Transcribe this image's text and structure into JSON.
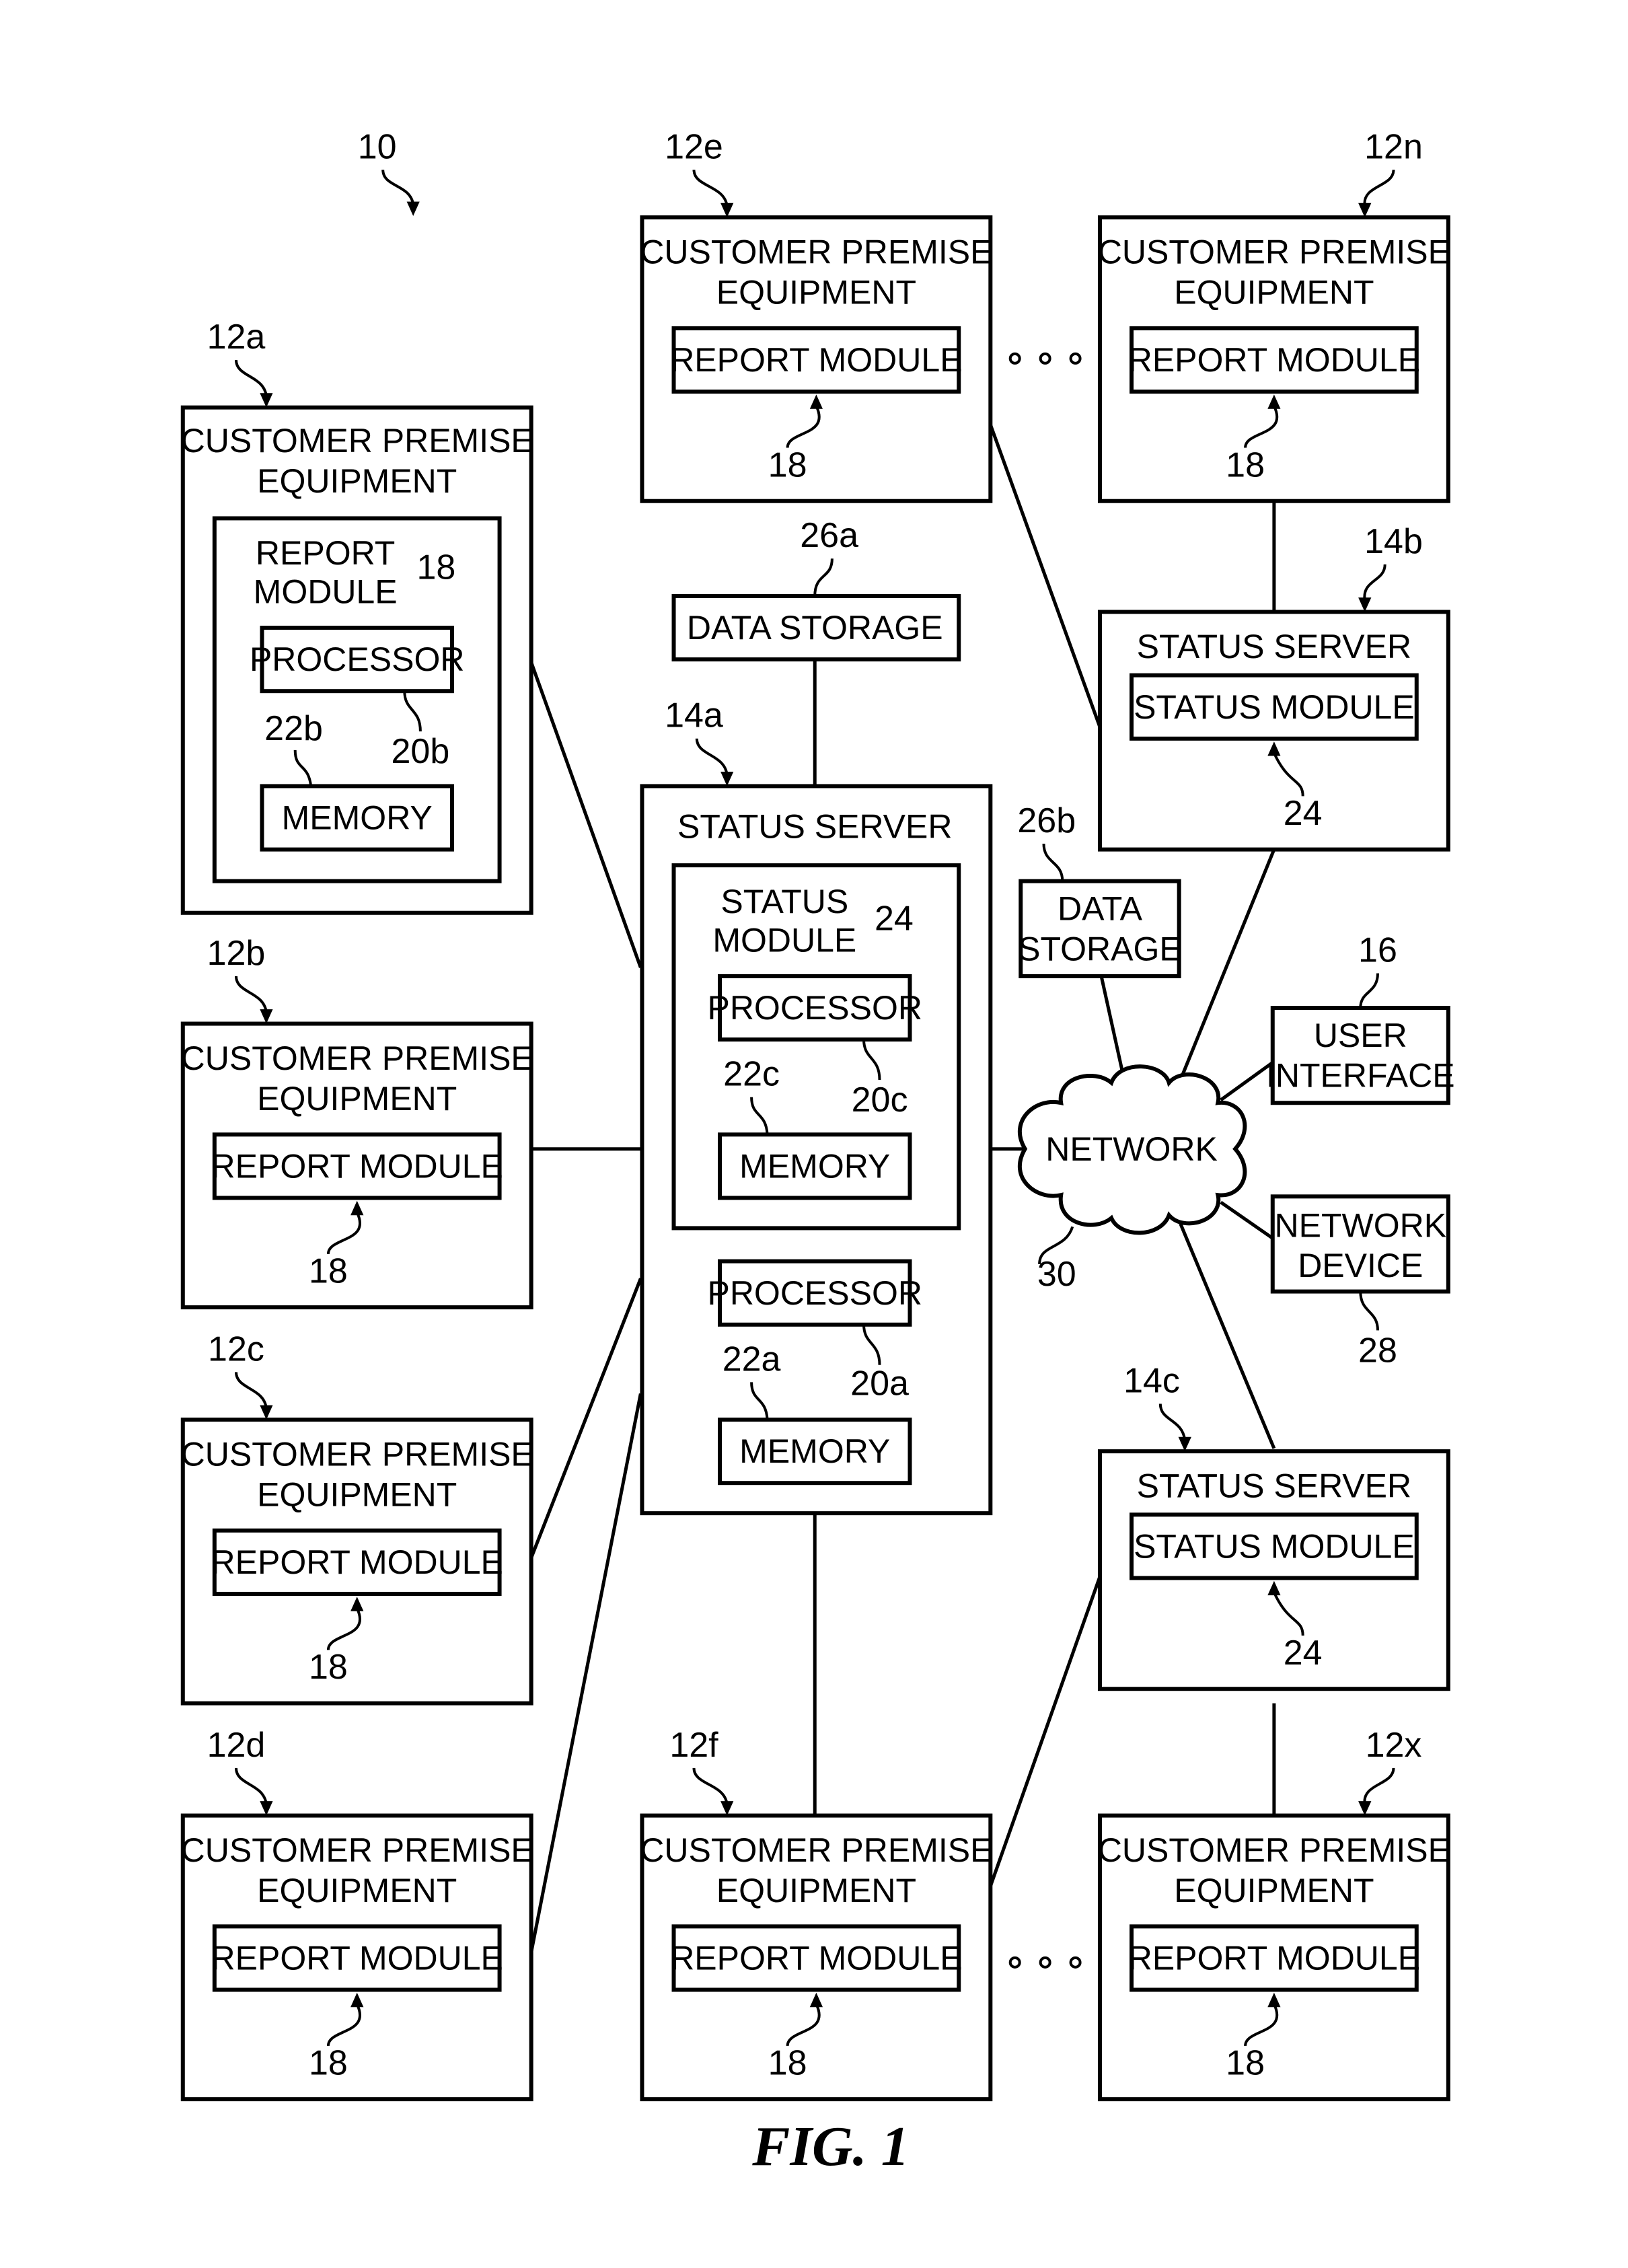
{
  "figure": {
    "system_ref": "10",
    "caption": "FIG. 1"
  },
  "labels": {
    "cpe_line1": "CUSTOMER PREMISE",
    "cpe_line2": "EQUIPMENT",
    "report_module": "REPORT MODULE",
    "report_module_line1": "REPORT",
    "report_module_line2": "MODULE",
    "status_server": "STATUS SERVER",
    "status_module": "STATUS MODULE",
    "status_module_line1": "STATUS",
    "status_module_line2": "MODULE",
    "processor": "PROCESSOR",
    "memory": "MEMORY",
    "data_storage": "DATA STORAGE",
    "data_storage_line1": "DATA",
    "data_storage_line2": "STORAGE",
    "network": "NETWORK",
    "user_interface_line1": "USER",
    "user_interface_line2": "INTERFACE",
    "network_device_line1": "NETWORK",
    "network_device_line2": "DEVICE",
    "ellipsis": "∘ ∘ ∘"
  },
  "refs": {
    "cpe_12a": "12a",
    "cpe_12b": "12b",
    "cpe_12c": "12c",
    "cpe_12d": "12d",
    "cpe_12e": "12e",
    "cpe_12f": "12f",
    "cpe_12n": "12n",
    "cpe_12x": "12x",
    "server_14a": "14a",
    "server_14b": "14b",
    "server_14c": "14c",
    "user_interface": "16",
    "report_module": "18",
    "processor_20a": "20a",
    "processor_20b": "20b",
    "processor_20c": "20c",
    "memory_22a": "22a",
    "memory_22b": "22b",
    "memory_22c": "22c",
    "status_module": "24",
    "data_storage_26a": "26a",
    "data_storage_26b": "26b",
    "network_device": "28",
    "network": "30"
  },
  "components": {
    "customer_premise_equipment": [
      {
        "id": "12a",
        "detail": "expanded",
        "contains": [
          "report module 18",
          "processor 20b",
          "memory 22b"
        ]
      },
      {
        "id": "12b"
      },
      {
        "id": "12c"
      },
      {
        "id": "12d"
      },
      {
        "id": "12e"
      },
      {
        "id": "12f"
      },
      {
        "id": "12n"
      },
      {
        "id": "12x"
      }
    ],
    "status_servers": [
      {
        "id": "14a",
        "contains": [
          "status module 24",
          "processor 20c",
          "memory 22c",
          "processor 20a",
          "memory 22a"
        ]
      },
      {
        "id": "14b",
        "contains": [
          "status module 24"
        ]
      },
      {
        "id": "14c",
        "contains": [
          "status module 24"
        ]
      }
    ],
    "connections": [
      [
        "12a",
        "14a"
      ],
      [
        "12b",
        "14a"
      ],
      [
        "12c",
        "14a"
      ],
      [
        "12d",
        "14a"
      ],
      [
        "12e",
        "14b"
      ],
      [
        "12n",
        "14b"
      ],
      [
        "12f",
        "14a"
      ],
      [
        "12f",
        "14c"
      ],
      [
        "12x",
        "14c"
      ],
      [
        "26a",
        "14a"
      ],
      [
        "14a",
        "30"
      ],
      [
        "26b",
        "30"
      ],
      [
        "14b",
        "30"
      ],
      [
        "16",
        "30"
      ],
      [
        "28",
        "30"
      ],
      [
        "14c",
        "30"
      ]
    ]
  }
}
